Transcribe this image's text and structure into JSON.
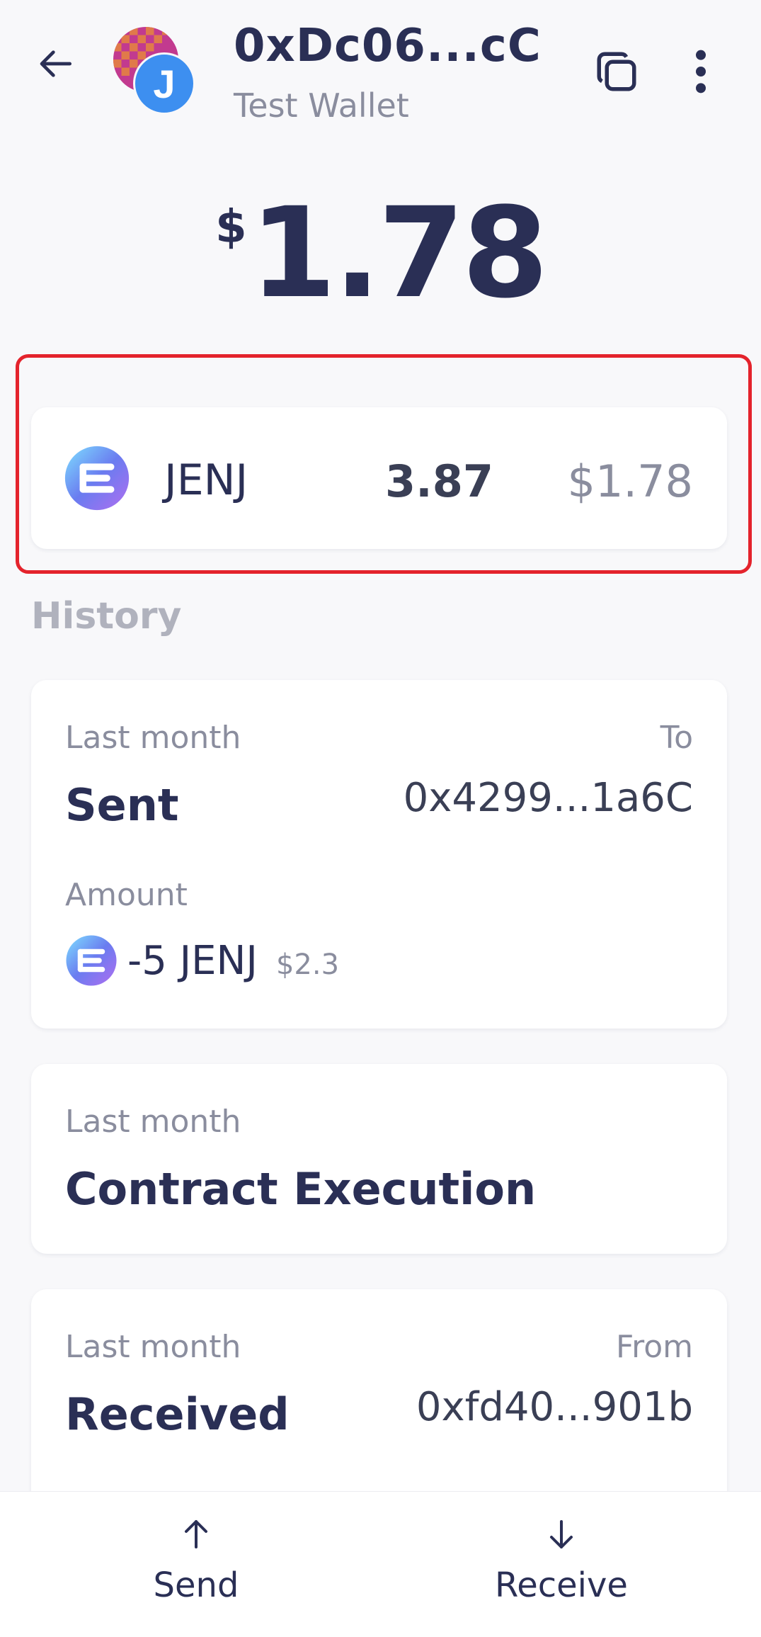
{
  "header": {
    "address": "0xDc06...cC",
    "wallet_name": "Test Wallet",
    "avatar_letter": "J",
    "icons": {
      "back": "arrow-left-icon",
      "copy": "copy-icon",
      "menu": "more-vertical-icon"
    }
  },
  "balance": {
    "currency": "$",
    "amount": "1.78"
  },
  "token": {
    "symbol": "JENJ",
    "quantity": "3.87",
    "value": "$1.78",
    "icon": "enjin-token-icon"
  },
  "history": {
    "title": "History",
    "items": [
      {
        "date": "Last month",
        "type": "Sent",
        "direction": "To",
        "address": "0x4299...1a6C",
        "amount_label": "Amount",
        "amount": "-5 JENJ",
        "amount_fiat": "$2.3"
      },
      {
        "date": "Last month",
        "type": "Contract Execution"
      },
      {
        "date": "Last month",
        "type": "Received",
        "direction": "From",
        "address": "0xfd40...901b"
      }
    ]
  },
  "actions": {
    "send_label": "Send",
    "receive_label": "Receive"
  },
  "colors": {
    "primary_text": "#2a2f55",
    "secondary_text": "#8a8d9e",
    "background": "#f8f8fa",
    "card": "#ffffff",
    "highlight": "#e4232c",
    "avatar_blue": "#3d8ff0"
  }
}
